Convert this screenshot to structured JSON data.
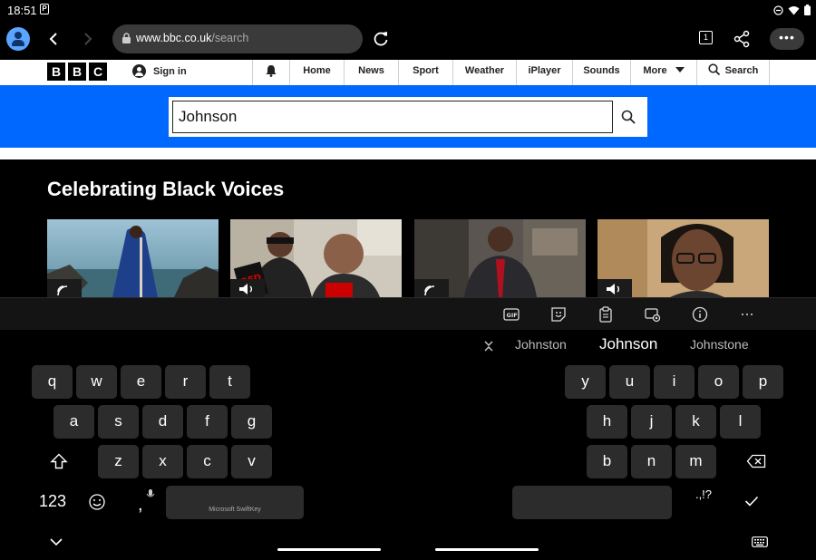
{
  "status_bar": {
    "time": "18:51",
    "colors": {
      "bg": "#000000",
      "fg": "#ffffff"
    }
  },
  "browser": {
    "url_domain": "www.bbc.co.uk",
    "url_path": "/search",
    "tab_count": "1",
    "colors": {
      "toolbar_bg": "#000000",
      "urlbar_bg": "#3a3a3a",
      "avatar": "#5aa5ff"
    }
  },
  "bbc_nav": {
    "logo": [
      "B",
      "B",
      "C"
    ],
    "signin_label": "Sign in",
    "items": [
      "Home",
      "News",
      "Sport",
      "Weather",
      "iPlayer",
      "Sounds"
    ],
    "more_label": "More",
    "search_label": "Search"
  },
  "search": {
    "value": "Johnson",
    "colors": {
      "band": "#0068ff"
    }
  },
  "content": {
    "section_title": "Celebrating Black Voices"
  },
  "keyboard": {
    "suggestions": [
      "Johnston",
      "Johnson",
      "Johnstone"
    ],
    "left_rows": [
      [
        "q",
        "w",
        "e",
        "r",
        "t"
      ],
      [
        "a",
        "s",
        "d",
        "f",
        "g"
      ],
      [
        "z",
        "x",
        "c",
        "v"
      ]
    ],
    "right_rows": [
      [
        "y",
        "u",
        "i",
        "o",
        "p"
      ],
      [
        "h",
        "j",
        "k",
        "l"
      ],
      [
        "b",
        "n",
        "m"
      ]
    ],
    "numbers_label": "123",
    "comma_label": ",",
    "space_label": "Microsoft SwiftKey",
    "punct_label": ".,!?",
    "toolbar_icons": [
      "gif-icon",
      "sticker-icon",
      "clipboard-icon",
      "settings-icon",
      "info-icon",
      "more-icon"
    ]
  }
}
